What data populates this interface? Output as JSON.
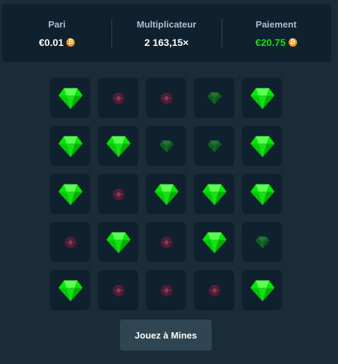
{
  "stats": {
    "bet": {
      "label": "Pari",
      "value": "€0.01"
    },
    "multiplier": {
      "label": "Multiplicateur",
      "value": "2 163,15×"
    },
    "payout": {
      "label": "Paiement",
      "value": "€20.75"
    },
    "coin_icon": "bitcoin-icon",
    "coin_symbol": "₿",
    "colors": {
      "coin": "#f7931a",
      "payout": "#00e701"
    }
  },
  "board": {
    "tiles": [
      "gem",
      "mine-dim",
      "mine-dim",
      "gem-dim",
      "gem",
      "gem",
      "gem",
      "gem-dim",
      "gem-dim",
      "gem",
      "gem",
      "mine-dim",
      "gem",
      "gem",
      "gem",
      "mine-dim",
      "gem",
      "mine-dim",
      "gem",
      "gem-dim",
      "gem",
      "mine-dim",
      "mine-dim",
      "mine-dim",
      "gem"
    ],
    "colors": {
      "gem": "#00e701",
      "mine": "#8a1538",
      "tile": "#0f212e"
    }
  },
  "play_button": {
    "label": "Jouez à Mines"
  }
}
